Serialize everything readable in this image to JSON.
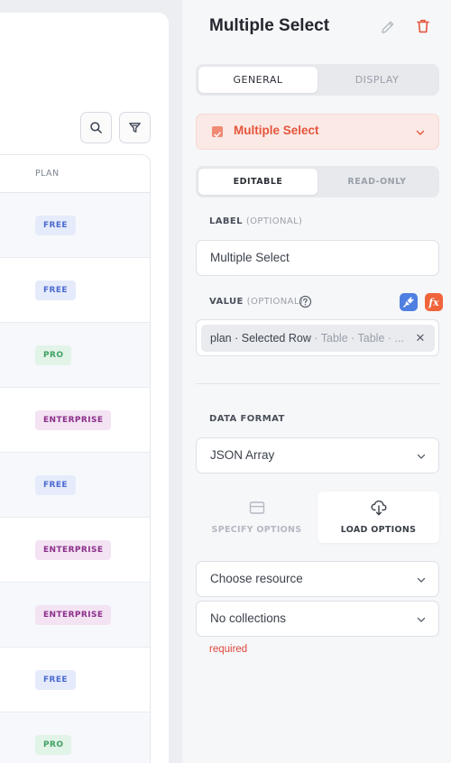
{
  "table": {
    "column_header": "PLAN",
    "rows": [
      {
        "plan": "FREE",
        "tone": "free"
      },
      {
        "plan": "FREE",
        "tone": "free"
      },
      {
        "plan": "PRO",
        "tone": "pro"
      },
      {
        "plan": "ENTERPRISE",
        "tone": "enterprise"
      },
      {
        "plan": "FREE",
        "tone": "free"
      },
      {
        "plan": "ENTERPRISE",
        "tone": "enterprise"
      },
      {
        "plan": "ENTERPRISE",
        "tone": "enterprise"
      },
      {
        "plan": "FREE",
        "tone": "free"
      },
      {
        "plan": "PRO",
        "tone": "pro"
      }
    ]
  },
  "toolbar": {
    "search_icon": "search-icon",
    "filter_icon": "filter-icon"
  },
  "panel": {
    "title": "Multiple Select",
    "tabs": {
      "general": "GENERAL",
      "display": "DISPLAY",
      "active": "general"
    },
    "component": {
      "label": "Multiple Select",
      "icon": "checkbox-icon",
      "accent": "#e5553b"
    },
    "mode": {
      "editable": "EDITABLE",
      "read_only": "READ-ONLY",
      "active": "editable"
    },
    "label_field": {
      "label": "LABEL",
      "optional": "(OPTIONAL)",
      "value": "Multiple Select"
    },
    "value_field": {
      "label": "VALUE",
      "optional": "(OPTIONAL)",
      "chip_main": "plan · Selected Row",
      "chip_path": " · Table · Table · ...",
      "remove": "✕",
      "fx": "fx"
    },
    "data_format": {
      "label": "DATA FORMAT",
      "value": "JSON Array"
    },
    "options_tabs": {
      "specify": "SPECIFY OPTIONS",
      "load": "LOAD OPTIONS",
      "active": "load"
    },
    "resource": {
      "value": "Choose resource"
    },
    "collections": {
      "value": "No collections"
    },
    "required": "required"
  }
}
